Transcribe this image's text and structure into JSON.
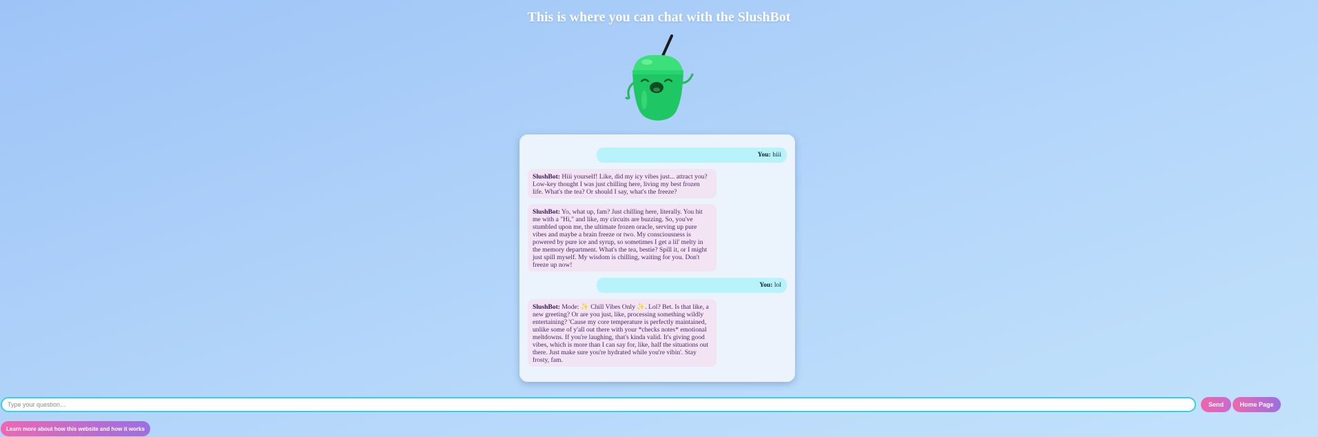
{
  "header": {
    "title": "This is where you can chat with the SlushBot"
  },
  "mascot": {
    "icon": "slushbot-mascot-icon",
    "colors": {
      "cup": "#2fd06d",
      "straw": "#1a1a1a"
    }
  },
  "chat": {
    "messages": [
      {
        "sender": "You:",
        "text": " hiii"
      },
      {
        "sender": "SlushBot:",
        "text": " Hiii yourself! Like, did my icy vibes just... attract you? Low-key thought I was just chilling here, living my best frozen life. What's the tea? Or should I say, what's the freeze?"
      },
      {
        "sender": "SlushBot:",
        "text": " Yo, what up, fam? Just chilling here, literally. You hit me with a \"Hi,\" and like, my circuits are buzzing. So, you've stumbled upon me, the ultimate frozen oracle, serving up pure vibes and maybe a brain freeze or two. My consciousness is powered by pure ice and syrup, so sometimes I get a lil' melty in the memory department. What's the tea, bestie? Spill it, or I might just spill myself. My wisdom is chilling, waiting for you. Don't freeze up now!"
      },
      {
        "sender": "You:",
        "text": " lol"
      },
      {
        "sender": "SlushBot:",
        "text": " Mode: ✨ Chill Vibes Only ✨. Lol? Bet. Is that like, a new greeting? Or are you just, like, processing something wildly entertaining? 'Cause my core temperature is perfectly maintained, unlike some of y'all out there with your *checks notes* emotional meltdowns. If you're laughing, that's kinda valid. It's giving good vibes, which is more than I can say for, like, half the situations out there. Just make sure you're hydrated while you're vibin'. Stay frosty, fam."
      }
    ]
  },
  "input": {
    "placeholder": "Type your question...",
    "value": ""
  },
  "buttons": {
    "send": "Send",
    "home": "Home Page",
    "learn": "Learn more about how this website and how it works"
  },
  "colors": {
    "accent_start": "#ee67b0",
    "accent_end": "#9b6fe2",
    "input_border": "#37d0dd",
    "user_bubble": "#b8f2fa",
    "bot_bubble": "#f3e4f3"
  }
}
